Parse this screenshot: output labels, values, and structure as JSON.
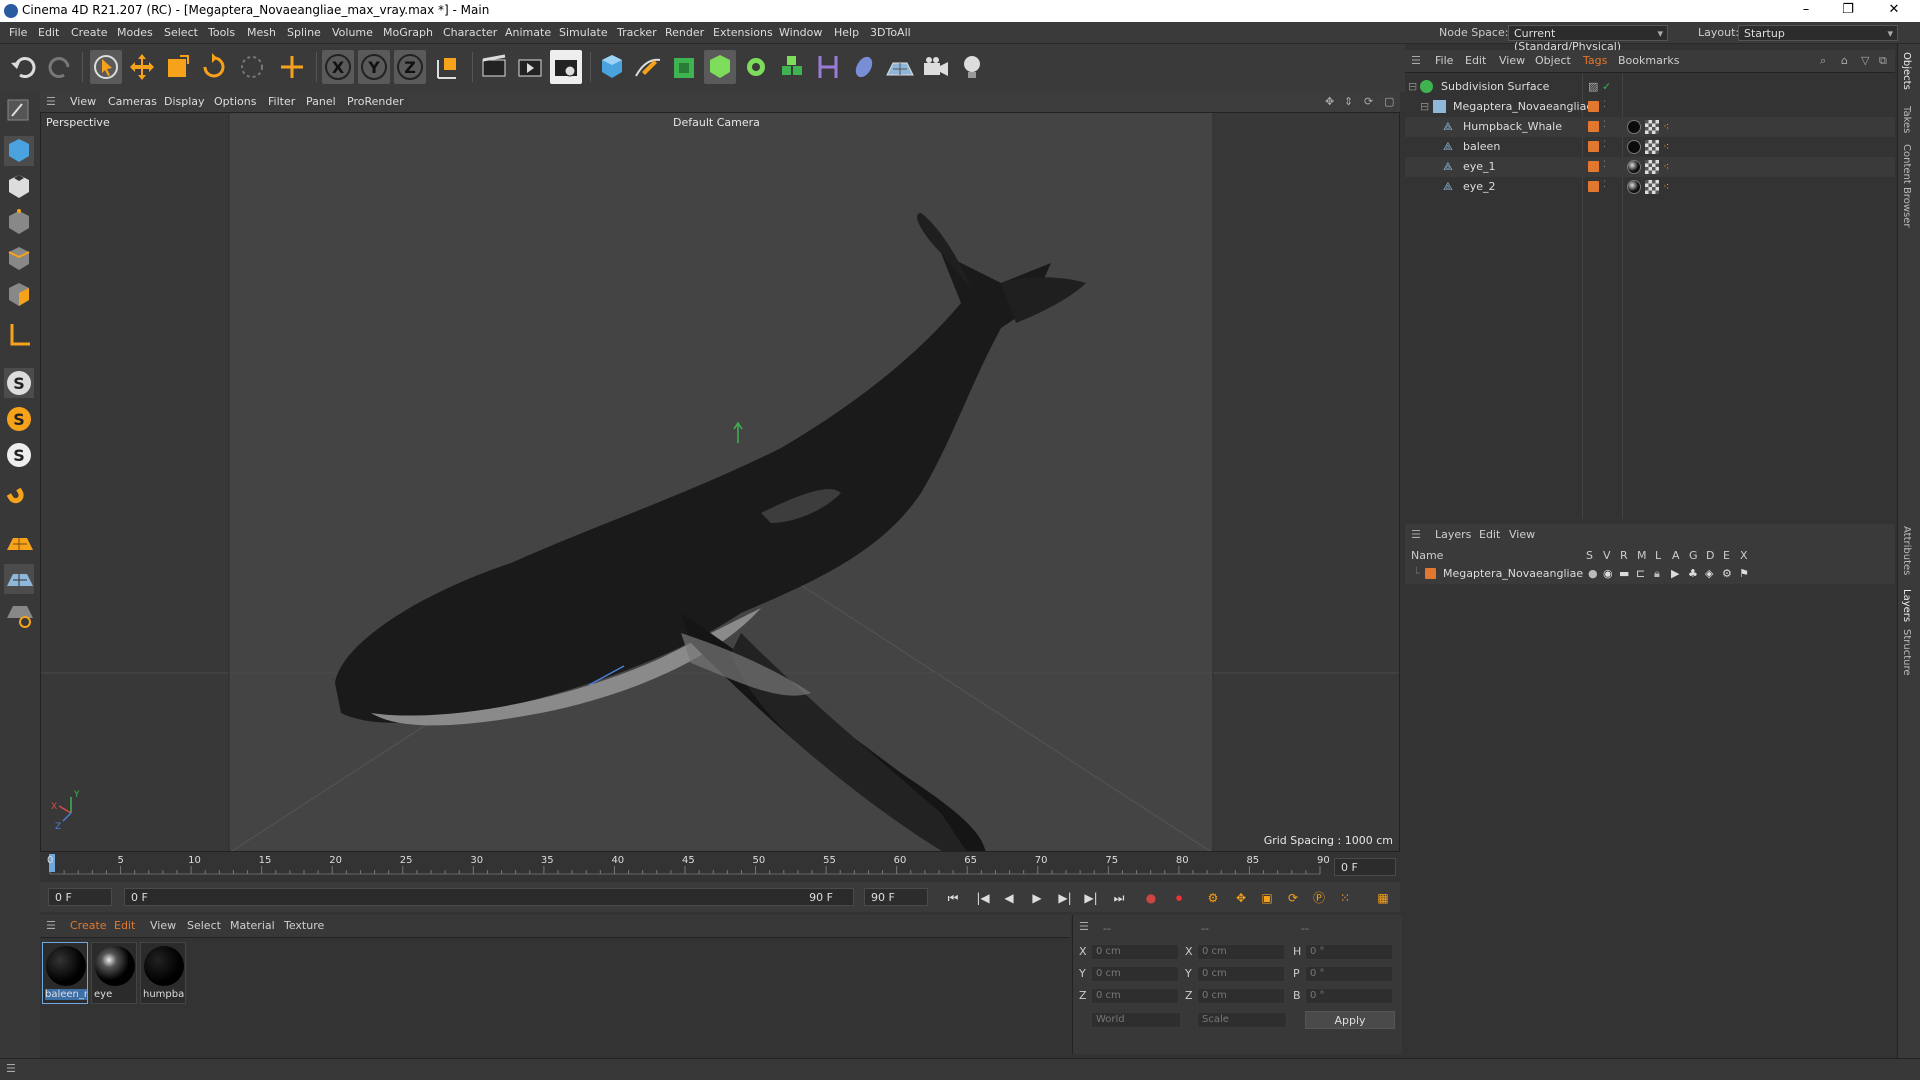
{
  "window": {
    "title": "Cinema 4D R21.207 (RC) - [Megaptera_Novaeangliae_max_vray.max *] - Main",
    "controls": [
      "–",
      "❐",
      "✕"
    ]
  },
  "menubar": {
    "items": [
      "File",
      "Edit",
      "Create",
      "Modes",
      "Select",
      "Tools",
      "Mesh",
      "Spline",
      "Volume",
      "MoGraph",
      "Character",
      "Animate",
      "Simulate",
      "Tracker",
      "Render",
      "Extensions",
      "Window",
      "Help",
      "3DToAll"
    ],
    "node_space_label": "Node Space:",
    "node_space_value": "Current (Standard/Physical)",
    "layout_label": "Layout:",
    "layout_value": "Startup"
  },
  "viewport": {
    "menu": [
      "View",
      "Cameras",
      "Display",
      "Options",
      "Filter",
      "Panel",
      "ProRender"
    ],
    "projection": "Perspective",
    "camera": "Default Camera",
    "grid_spacing": "Grid Spacing : 1000 cm"
  },
  "timeline": {
    "ticks": [
      "0",
      "5",
      "10",
      "15",
      "20",
      "25",
      "30",
      "35",
      "40",
      "45",
      "50",
      "55",
      "60",
      "65",
      "70",
      "75",
      "80",
      "85",
      "90"
    ],
    "current_frame_right": "0 F",
    "start_field": "0 F",
    "range_start": "0 F",
    "range_end": "90 F",
    "end_field": "90 F"
  },
  "material_manager": {
    "menu": [
      "Create",
      "Edit",
      "View",
      "Select",
      "Material",
      "Texture"
    ],
    "materials": [
      {
        "name": "baleen_r"
      },
      {
        "name": "eye"
      },
      {
        "name": "humpba"
      }
    ]
  },
  "coordinates": {
    "col_headers": [
      "--",
      "--",
      "--"
    ],
    "rows": [
      {
        "axis": "X",
        "pos": "0 cm",
        "axis2": "X",
        "size": "0 cm",
        "rot_axis": "H",
        "rot": "0 °"
      },
      {
        "axis": "Y",
        "pos": "0 cm",
        "axis2": "Y",
        "size": "0 cm",
        "rot_axis": "P",
        "rot": "0 °"
      },
      {
        "axis": "Z",
        "pos": "0 cm",
        "axis2": "Z",
        "size": "0 cm",
        "rot_axis": "B",
        "rot": "0 °"
      }
    ],
    "world_label": "World",
    "scale_label": "Scale",
    "apply_label": "Apply"
  },
  "object_manager": {
    "menu": [
      "File",
      "Edit",
      "View",
      "Object",
      "Tags",
      "Bookmarks"
    ],
    "objects": [
      {
        "name": "Subdivision Surface"
      },
      {
        "name": "Megaptera_Novaeangliae"
      },
      {
        "name": "Humpback_Whale"
      },
      {
        "name": "baleen"
      },
      {
        "name": "eye_1"
      },
      {
        "name": "eye_2"
      }
    ]
  },
  "layer_manager": {
    "menu": [
      "Layers",
      "Edit",
      "View"
    ],
    "columns": [
      "Name",
      "S",
      "V",
      "R",
      "M",
      "L",
      "A",
      "G",
      "D",
      "E",
      "X"
    ],
    "layers": [
      {
        "name": "Megaptera_Novaeangliae",
        "color": "#e2782f"
      }
    ]
  },
  "side_tabs": [
    "Objects",
    "Takes",
    "Content Browser",
    "Attributes",
    "Layers",
    "Structure"
  ],
  "colors": {
    "accent_orange": "#e2782f",
    "viewport_bg": "#3d3d3d",
    "panel_bg": "#333333"
  }
}
